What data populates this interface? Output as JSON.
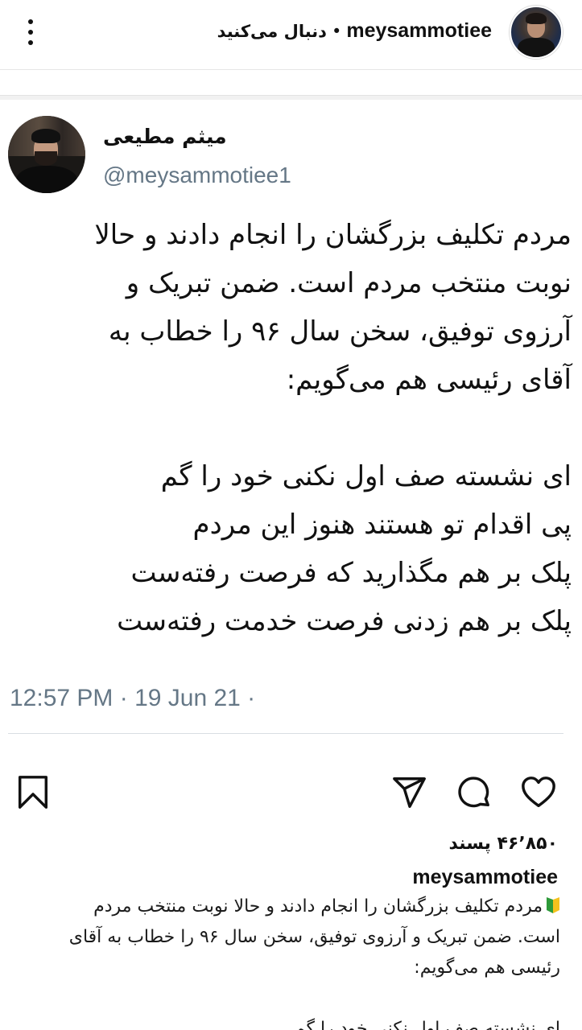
{
  "header": {
    "username": "meysammotiee",
    "separator": "•",
    "follow_label": "دنبال می‌کنید",
    "more_icon": "more-vertical-icon"
  },
  "tweet": {
    "name": "میثم مطیعی",
    "handle": "@meysammotiee1",
    "lines": [
      "مردم تکلیف بزرگشان را انجام دادند و حالا",
      "نوبت منتخب مردم است. ضمن تبریک و",
      "آرزوی توفیق، سخن سال ۹۶ را خطاب به",
      "آقای رئیسی هم می‌گویم:"
    ],
    "poem": [
      "ای نشسته صف اول نکنی خود را گم",
      "پی اقدام تو هستند هنوز این مردم",
      "پلک بر هم مگذارید که فرصت رفته‌ست",
      "پلک بر هم زدنی فرصت خدمت رفته‌ست"
    ],
    "meta": "12:57 PM · 19 Jun 21 ·"
  },
  "actions": {
    "like_icon": "heart-icon",
    "comment_icon": "comment-icon",
    "share_icon": "send-icon",
    "save_icon": "bookmark-icon"
  },
  "likes": "۴۶٬۸۵۰ پسند",
  "caption": {
    "username": "meysammotiee",
    "emoji": "beginner-badge-icon",
    "lines": [
      "مردم تکلیف بزرگشان را انجام دادند و حالا نوبت منتخب مردم",
      "است. ضمن تبریک و آرزوی توفیق، سخن سال ۹۶ را خطاب به آقای",
      "رئیسی هم می‌گویم:"
    ],
    "next_line": "ای نشسته صف اول نکنی خود را گم"
  },
  "colors": {
    "text": "#111111",
    "muted": "#657786",
    "divider": "#d9dee2"
  }
}
